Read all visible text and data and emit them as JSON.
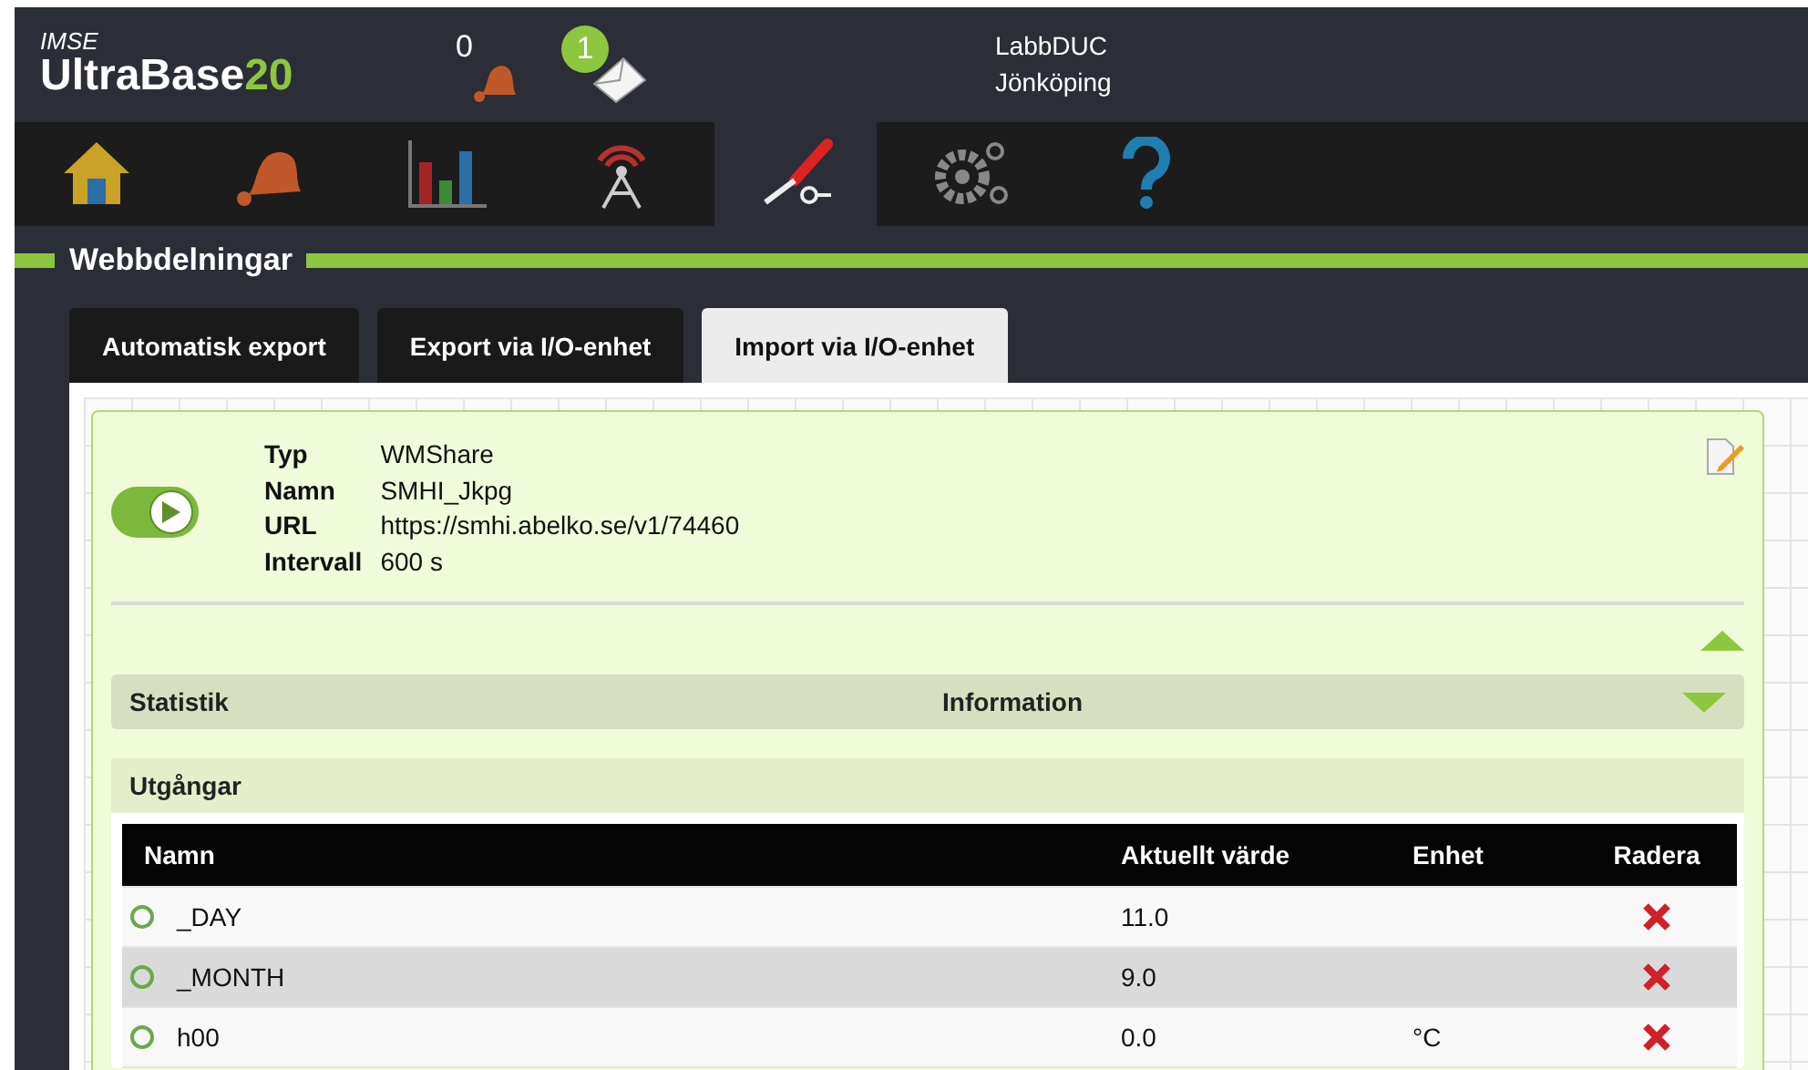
{
  "header": {
    "brand_small": "IMSE",
    "brand_main": "UltraBase",
    "brand_number": "20",
    "alarm_count": "0",
    "message_count": "1",
    "site_name": "LabbDUC",
    "site_location": "Jönköping"
  },
  "nav": [
    {
      "kind": "home",
      "selected": false
    },
    {
      "kind": "bell",
      "selected": false
    },
    {
      "kind": "chart",
      "selected": false
    },
    {
      "kind": "antenna",
      "selected": false
    },
    {
      "kind": "tools",
      "selected": true
    },
    {
      "kind": "gears",
      "selected": false
    },
    {
      "kind": "help",
      "selected": false
    }
  ],
  "section_title": "Webbdelningar",
  "tabs": [
    {
      "label": "Automatisk export",
      "selected": false
    },
    {
      "label": "Export via I/O-enhet",
      "selected": false
    },
    {
      "label": "Import via I/O-enhet",
      "selected": true
    }
  ],
  "share": {
    "on": true,
    "expanded": true,
    "fields": [
      {
        "label": "Typ",
        "value": "WMShare"
      },
      {
        "label": "Namn",
        "value": "SMHI_Jkpg"
      },
      {
        "label": "URL",
        "value": "https://smhi.abelko.se/v1/74460"
      },
      {
        "label": "Intervall",
        "value": "600 s"
      }
    ]
  },
  "info_bar": {
    "left": "Statistik",
    "center": "Information",
    "expanded": false
  },
  "outputs": {
    "title": "Utgångar",
    "columns": [
      "Namn",
      "Aktuellt värde",
      "Enhet",
      "Radera"
    ],
    "rows": [
      {
        "name": "_DAY",
        "value": "11.0",
        "unit": ""
      },
      {
        "name": "_MONTH",
        "value": "9.0",
        "unit": ""
      },
      {
        "name": "h00",
        "value": "0.0",
        "unit": "°C"
      }
    ]
  }
}
